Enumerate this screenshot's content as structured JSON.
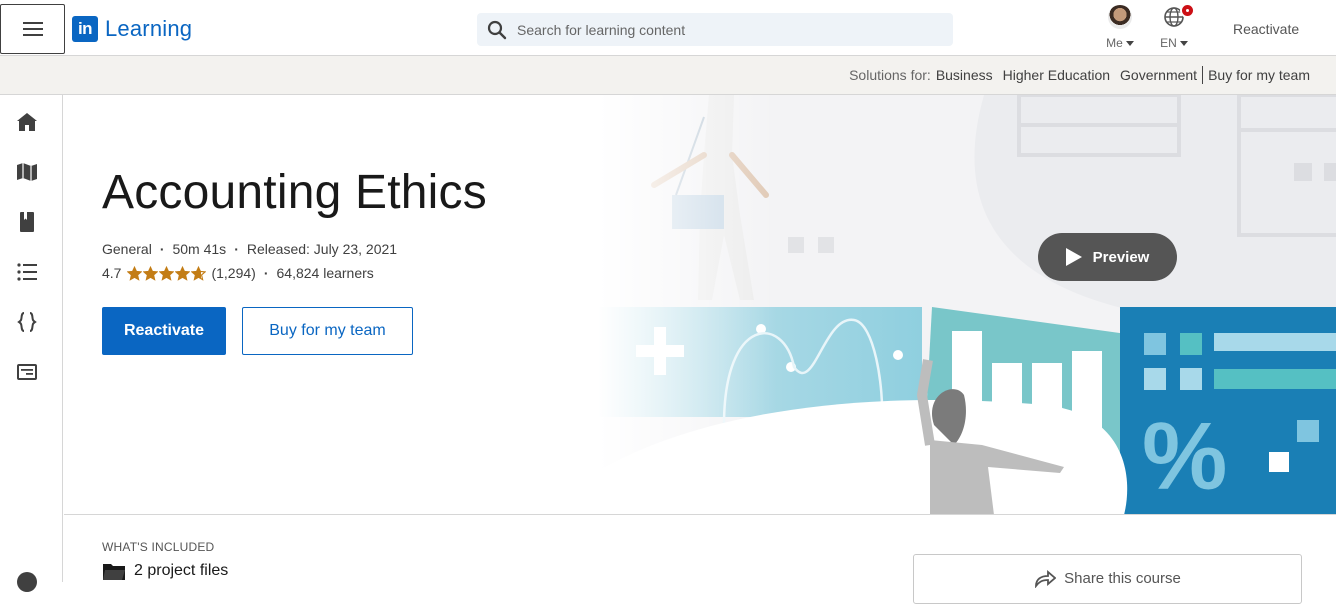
{
  "header": {
    "logo_mark": "in",
    "logo_text": "Learning",
    "search_placeholder": "Search for learning content",
    "me_label": "Me",
    "lang_label": "EN",
    "reactivate_label": "Reactivate"
  },
  "solutions": {
    "prefix": "Solutions for:",
    "links": [
      "Business",
      "Higher Education",
      "Government"
    ],
    "buy_label": "Buy for my team"
  },
  "sidebar": {
    "icons": [
      "home-icon",
      "map-icon",
      "book-icon",
      "list-icon",
      "code-braces-icon",
      "certificate-icon",
      "help-icon"
    ]
  },
  "course": {
    "title": "Accounting Ethics",
    "level": "General",
    "duration": "50m 41s",
    "released": "Released: July 23, 2021",
    "rating": "4.7",
    "rating_value": 4.7,
    "rating_max": 5,
    "ratings_count": "(1,294)",
    "learners": "64,824 learners",
    "primary_button": "Reactivate",
    "secondary_button": "Buy for my team",
    "preview_label": "Preview"
  },
  "included": {
    "label": "WHAT'S INCLUDED",
    "items": [
      "2 project files"
    ]
  },
  "share": {
    "label": "Share this course"
  },
  "colors": {
    "brand": "#0a66c2",
    "star": "#c37d16",
    "notification": "#cc1016"
  }
}
